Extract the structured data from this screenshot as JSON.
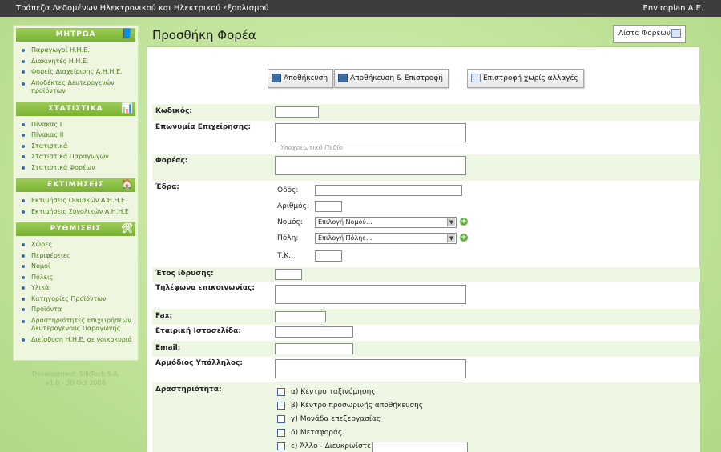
{
  "topbar": {
    "title": "Τράπεζα Δεδομένων Ηλεκτρονικού και Ηλεκτρικού εξοπλισμού",
    "company": "Enviroplan A.E."
  },
  "sidebar": {
    "sections": [
      {
        "title": "ΜΗΤΡΩΑ",
        "icon": "book-icon",
        "items": [
          "Παραγωγοί Η.Η.Ε.",
          "Διακινητές Η.Η.Ε.",
          "Φορείς Διαχείρισης Α.Η.Η.Ε.",
          "Αποδέκτες Δευτερογενών προϊόντων"
        ]
      },
      {
        "title": "ΣΤΑΤΙΣΤΙΚΑ",
        "icon": "chart-icon",
        "items": [
          "Πίνακας Ι",
          "Πίνακας ΙΙ",
          "Στατιστικά",
          "Στατιστικά Παραγωγών",
          "Στατιστικά Φορέων"
        ]
      },
      {
        "title": "ΕΚΤΙΜΗΣΕΙΣ",
        "icon": "house-icon",
        "items": [
          "Εκτιμήσεις Οικιακών Α.Η.Η.Ε",
          "Εκτιμήσεις Συνολικών Α.Η.Η.Ε"
        ]
      },
      {
        "title": "ΡΥΘΜΙΣΕΙΣ",
        "icon": "tools-icon",
        "items": [
          "Χώρες",
          "Περιφέρειες",
          "Νομοί",
          "Πόλεις",
          "Υλικά",
          "Κατηγορίες Προϊόντων",
          "Προϊόντα",
          "Δραστηριότητες Επιχειρήσεων Δευτερογενούς Παραγωγής",
          "Διείσδυση Η.Η.Ε. σε νοικοκυριά"
        ]
      }
    ],
    "dev_line1": "Development: SilkTech S.A.",
    "dev_line2": "v1.0 - 30 Oct 2008"
  },
  "page": {
    "title": "Προσθήκη Φορέα",
    "list_button": "Λίστα Φορέων",
    "buttons": {
      "save": "Αποθήκευση",
      "save_return": "Αποθήκευση & Επιστροφή",
      "return_no_changes": "Επιστροφή χωρίς αλλαγές"
    }
  },
  "form": {
    "code": "Κωδικός:",
    "company_name": "Επωνυμία Επιχείρησης:",
    "required_hint": "Υποχρεωτικό Πεδίο",
    "entity": "Φορέας:",
    "seat": "Έδρα:",
    "street": "Οδός:",
    "number": "Αριθμός:",
    "prefecture": "Νομός:",
    "prefecture_select": "Επιλογή Νομού...",
    "city": "Πόλη:",
    "city_select": "Επιλογή Πόλης...",
    "postal": "Τ.Κ.:",
    "founded": "Έτος ίδρυσης:",
    "phones": "Τηλέφωνα επικοινωνίας:",
    "fax": "Fax:",
    "website": "Εταιρική Ιστοσελίδα:",
    "email": "Email:",
    "employee": "Αρμόδιος Υπάλληλος:",
    "activity": "Δραστηριότητα:",
    "activities": [
      "α) Κέντρο ταξινόμησης",
      "β) Κέντρο προσωρινής αποθήκευσης",
      "γ) Μονάδα επεξεργασίας",
      "δ) Μεταφοράς",
      "ε) Άλλο - Διευκρινίστε:"
    ]
  }
}
